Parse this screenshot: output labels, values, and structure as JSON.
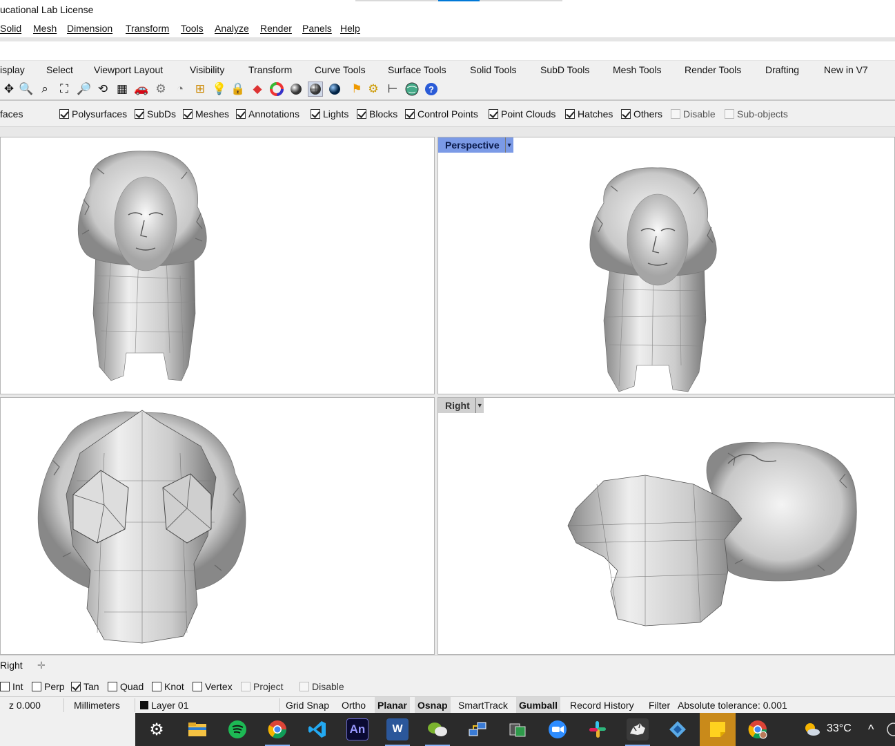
{
  "window": {
    "title": "ucational Lab License"
  },
  "menu": [
    "Solid",
    "Mesh",
    "Dimension",
    "Transform",
    "Tools",
    "Analyze",
    "Render",
    "Panels",
    "Help"
  ],
  "tabs": [
    "isplay",
    "Select",
    "Viewport Layout",
    "Visibility",
    "Transform",
    "Curve Tools",
    "Surface Tools",
    "Solid Tools",
    "SubD Tools",
    "Mesh Tools",
    "Render Tools",
    "Drafting",
    "New in V7"
  ],
  "toolbar_icons": [
    "pan-icon",
    "zoom-icon",
    "zoom-window-icon",
    "zoom-extents-icon",
    "zoom-selected-icon",
    "rotate-view-icon",
    "four-viewports-icon",
    "car-icon",
    "named-view-icon",
    "clock-icon",
    "cplane-icon",
    "light-bulb-icon",
    "lock-icon",
    "layer-icon",
    "color-wheel-icon",
    "shaded-sphere-icon",
    "rendered-sphere-icon",
    "blue-sphere-icon",
    "highlight-icon",
    "gear-icon",
    "dimension-icon",
    "globe-icon",
    "help-icon"
  ],
  "filters": [
    {
      "label": "faces",
      "checkbox": false
    },
    {
      "label": "Polysurfaces",
      "checked": true
    },
    {
      "label": "SubDs",
      "checked": true
    },
    {
      "label": "Meshes",
      "checked": true
    },
    {
      "label": "Annotations",
      "checked": true
    },
    {
      "label": "Lights",
      "checked": true
    },
    {
      "label": "Blocks",
      "checked": true
    },
    {
      "label": "Control Points",
      "checked": true
    },
    {
      "label": "Point Clouds",
      "checked": true
    },
    {
      "label": "Hatches",
      "checked": true
    },
    {
      "label": "Others",
      "checked": true
    },
    {
      "label": "Disable",
      "checked": false,
      "disabled": true
    },
    {
      "label": "Sub-objects",
      "checked": false,
      "disabled": true
    }
  ],
  "viewports": {
    "perspective_label": "Perspective",
    "right_label": "Right"
  },
  "viewport_tabs": {
    "current": "Right",
    "add_symbol": "✛"
  },
  "osnaps": [
    {
      "label": "Int",
      "checked": false
    },
    {
      "label": "Perp",
      "checked": false
    },
    {
      "label": "Tan",
      "checked": true
    },
    {
      "label": "Quad",
      "checked": false
    },
    {
      "label": "Knot",
      "checked": false
    },
    {
      "label": "Vertex",
      "checked": false
    },
    {
      "label": "Project",
      "checked": false,
      "disabled": true
    },
    {
      "label": "Disable",
      "checked": false,
      "disabled": true
    }
  ],
  "status": {
    "z": "z 0.000",
    "units": "Millimeters",
    "layer": "Layer 01",
    "grid_snap": "Grid Snap",
    "ortho": "Ortho",
    "planar": "Planar",
    "osnap": "Osnap",
    "smarttrack": "SmartTrack",
    "gumball": "Gumball",
    "record_history": "Record History",
    "filter": "Filter",
    "tolerance": "Absolute tolerance: 0.001"
  },
  "taskbar": {
    "apps": [
      "settings-icon",
      "file-explorer-icon",
      "spotify-icon",
      "chrome-icon",
      "vscode-icon",
      "animate-icon",
      "word-icon",
      "wechat-icon",
      "network-icon",
      "snip-icon",
      "zoom-icon",
      "slack-icon",
      "rhino-icon",
      "app-icon",
      "sticky-notes-icon",
      "chrome-profile-icon"
    ],
    "animate_text": "An",
    "word_text": "W",
    "temperature": "33°C",
    "tray_symbol": "^"
  }
}
